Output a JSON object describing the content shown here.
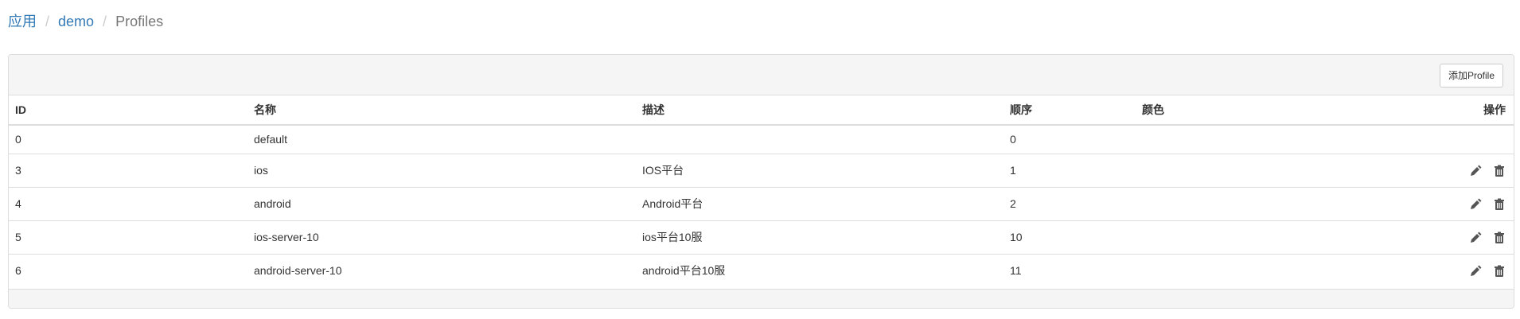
{
  "breadcrumb": {
    "items": [
      {
        "label": "应用"
      },
      {
        "label": "demo"
      },
      {
        "label": "Profiles"
      }
    ],
    "separator": "/"
  },
  "panel": {
    "add_button_label": "添加Profile"
  },
  "table": {
    "headers": {
      "id": "ID",
      "name": "名称",
      "desc": "描述",
      "order": "顺序",
      "color": "颜色",
      "ops": "操作"
    },
    "rows": [
      {
        "id": "0",
        "name": "default",
        "desc": "",
        "order": "0",
        "color": "",
        "actions": []
      },
      {
        "id": "3",
        "name": "ios",
        "desc": "IOS平台",
        "order": "1",
        "color": "",
        "actions": [
          "pencil-icon",
          "trash-icon"
        ]
      },
      {
        "id": "4",
        "name": "android",
        "desc": "Android平台",
        "order": "2",
        "color": "",
        "actions": [
          "pencil-icon",
          "trash-icon"
        ]
      },
      {
        "id": "5",
        "name": "ios-server-10",
        "desc": "ios平台10服",
        "order": "10",
        "color": "",
        "actions": [
          "pencil-icon",
          "trash-icon"
        ]
      },
      {
        "id": "6",
        "name": "android-server-10",
        "desc": "android平台10服",
        "order": "11",
        "color": "",
        "actions": [
          "pencil-icon",
          "trash-icon"
        ]
      }
    ]
  },
  "colors": {
    "link": "#337ab7",
    "border": "#dddddd",
    "heading_bg": "#f5f5f5",
    "icon": "#555555"
  }
}
